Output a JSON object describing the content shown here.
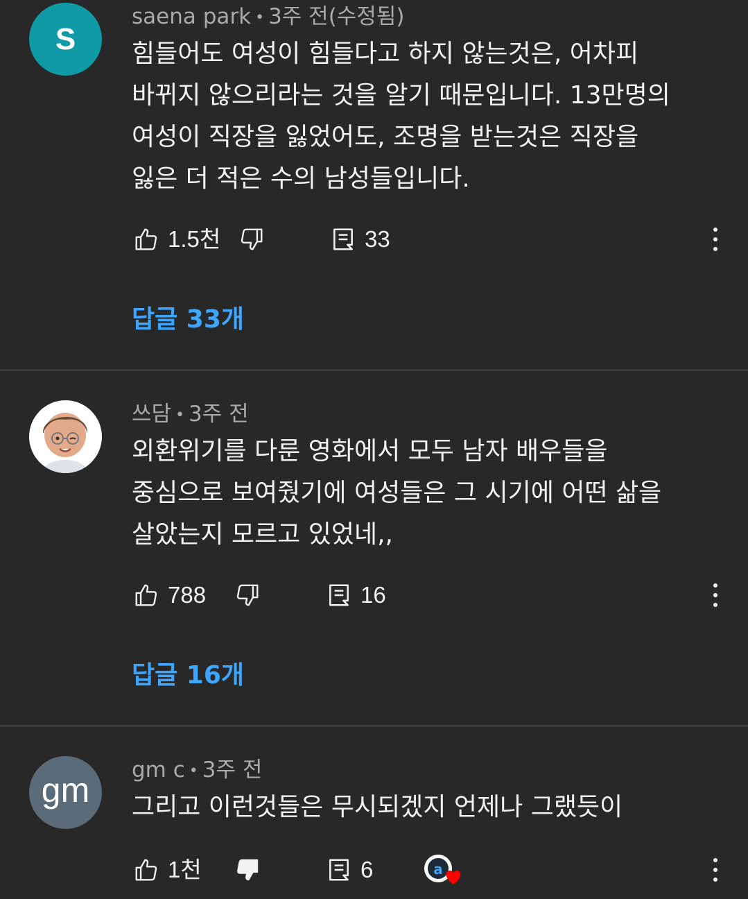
{
  "comments": [
    {
      "author": "saena park",
      "time": "3주 전(수정됨)",
      "avatar_letter": "S",
      "avatar_color": "#0f9aa6",
      "lines": [
        "힘들어도 여성이 힘들다고 하지 않는것은, 어차피",
        "바뀌지 않으리라는 것을 알기 때문입니다. 13만명의",
        "여성이 직장을 잃었어도, 조명을 받는것은 직장을",
        "잃은 더 적은 수의 남성들입니다."
      ],
      "likes": "1.5천",
      "reply_count": "33",
      "replies_label": "답글 33개"
    },
    {
      "author": "쓰담",
      "time": "3주 전",
      "avatar_letter": "",
      "avatar_color": "#ffffff",
      "lines": [
        "외환위기를 다룬 영화에서 모두 남자 배우들을",
        "중심으로 보여줬기에 여성들은 그 시기에 어떤 삶을",
        "살았는지 모르고 있었네,,"
      ],
      "likes": "788",
      "reply_count": "16",
      "replies_label": "답글 16개"
    },
    {
      "author": "gm c",
      "time": "3주 전",
      "avatar_letter": "gm",
      "avatar_color": "#5b6b77",
      "lines": [
        "그리고 이런것들은 무시되겠지 언제나 그랬듯이"
      ],
      "likes": "1천",
      "reply_count": "6"
    }
  ],
  "icons": {
    "like": "thumbs-up-icon",
    "dislike": "thumbs-down-icon",
    "reply": "reply-comment-icon",
    "more": "more-vertical-icon",
    "creator_heart": "creator-heart-badge-icon"
  },
  "colors": {
    "background": "#282828",
    "link": "#3ea6ff",
    "meta": "#aaaaaa",
    "heart": "#ff0000"
  }
}
